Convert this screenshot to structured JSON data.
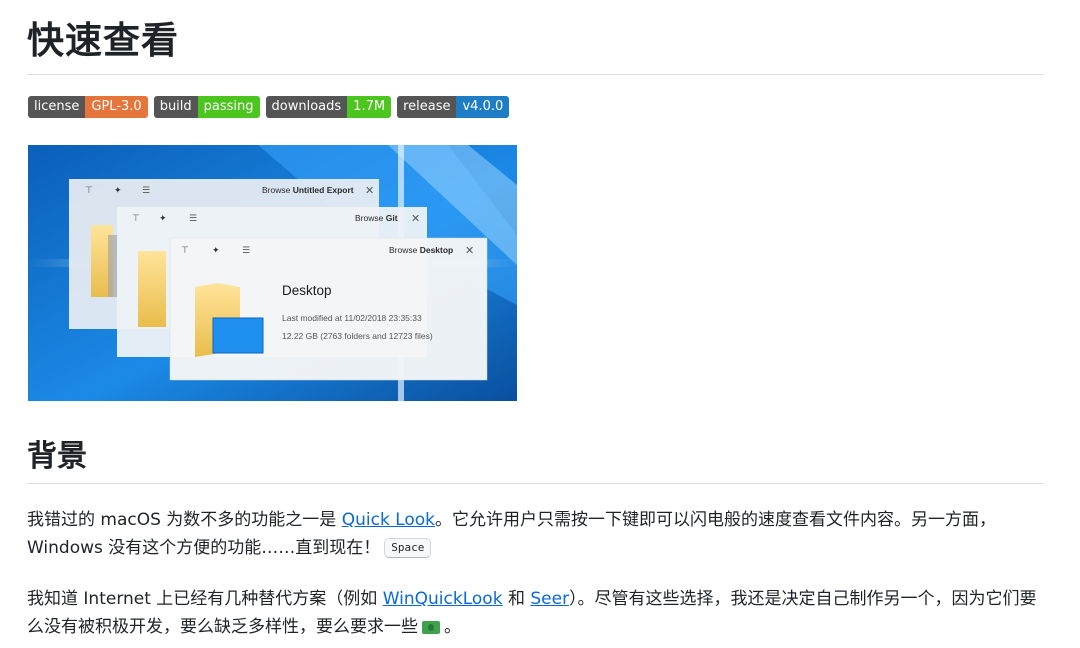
{
  "page": {
    "title": "快速查看"
  },
  "badges": [
    {
      "label": "license",
      "value": "GPL-3.0",
      "color": "#e5753a"
    },
    {
      "label": "build",
      "value": "passing",
      "color": "#4cc61e"
    },
    {
      "label": "downloads",
      "value": "1.7M",
      "color": "#4cc61e"
    },
    {
      "label": "release",
      "value": "v4.0.0",
      "color": "#1e7dc4"
    }
  ],
  "screenshot": {
    "windows": [
      {
        "title_prefix": "Browse ",
        "title_bold": "Untitled Export"
      },
      {
        "title_prefix": "Browse ",
        "title_bold": "Git"
      },
      {
        "title_prefix": "Browse ",
        "title_bold": "Desktop"
      }
    ],
    "preview": {
      "name": "Desktop",
      "modified": "Last modified at 11/02/2018 23:35:33",
      "size": "12.22 GB (2763 folders and 12723 files)"
    }
  },
  "background": {
    "heading": "背景",
    "p1": {
      "before": "我错过的 macOS 为数不多的功能之一是 ",
      "link": "Quick Look",
      "after": "。它允许用户只需按一下键即可以闪电般的速度查看文件内容。另一方面，Windows 没有这个方便的功能……直到现在！",
      "key": "Space"
    },
    "p2": {
      "before": "我知道 Internet 上已经有几种替代方案（例如 ",
      "link1": "WinQuickLook",
      "mid": " 和 ",
      "link2": "Seer",
      "after": "）。尽管有这些选择，我还是决定自己制作另一个，因为它们要么没有被积极开发，要么缺乏多样性，要么要求一些",
      "end": "。"
    }
  }
}
